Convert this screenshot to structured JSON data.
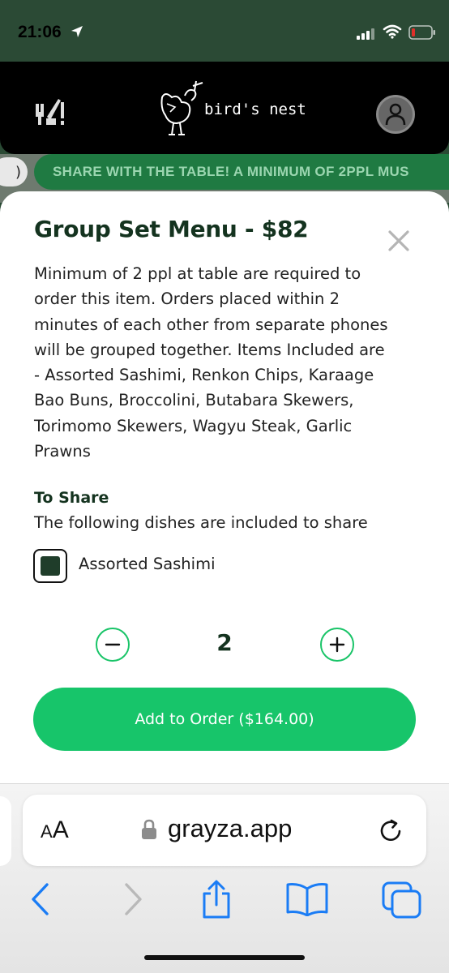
{
  "status_bar": {
    "time": "21:06"
  },
  "app_header": {
    "brand_name": "bird's nest"
  },
  "banner": {
    "chip_text": ")",
    "text": "SHARE WITH THE TABLE! A MINIMUM OF 2PPL MUS"
  },
  "modal": {
    "title": "Group Set Menu - $82",
    "description_lines": [
      "Minimum of 2 ppl at table are required to",
      "order this item. Orders placed within 2",
      "minutes of each other from separate phones",
      "will be grouped together. Items Included are",
      "- Assorted Sashimi, Renkon Chips, Karaage",
      "Bao Buns, Broccolini, Butabara Skewers,",
      "Torimomo Skewers, Wagyu Steak, Garlic",
      "Prawns"
    ],
    "section_title": "To Share",
    "section_subtitle": "The following dishes are included to share",
    "option_label": "Assorted Sashimi",
    "option_checked": true,
    "quantity": "2",
    "add_button_label": "Add to Order ($164.00)"
  },
  "browser": {
    "aa_small": "A",
    "aa_large": "A",
    "url": "grayza.app"
  },
  "colors": {
    "accent_green": "#17c56a",
    "dark_green_text": "#14331f",
    "status_bar_bg": "#2b4a35",
    "ios_blue": "#1a7cf5"
  }
}
